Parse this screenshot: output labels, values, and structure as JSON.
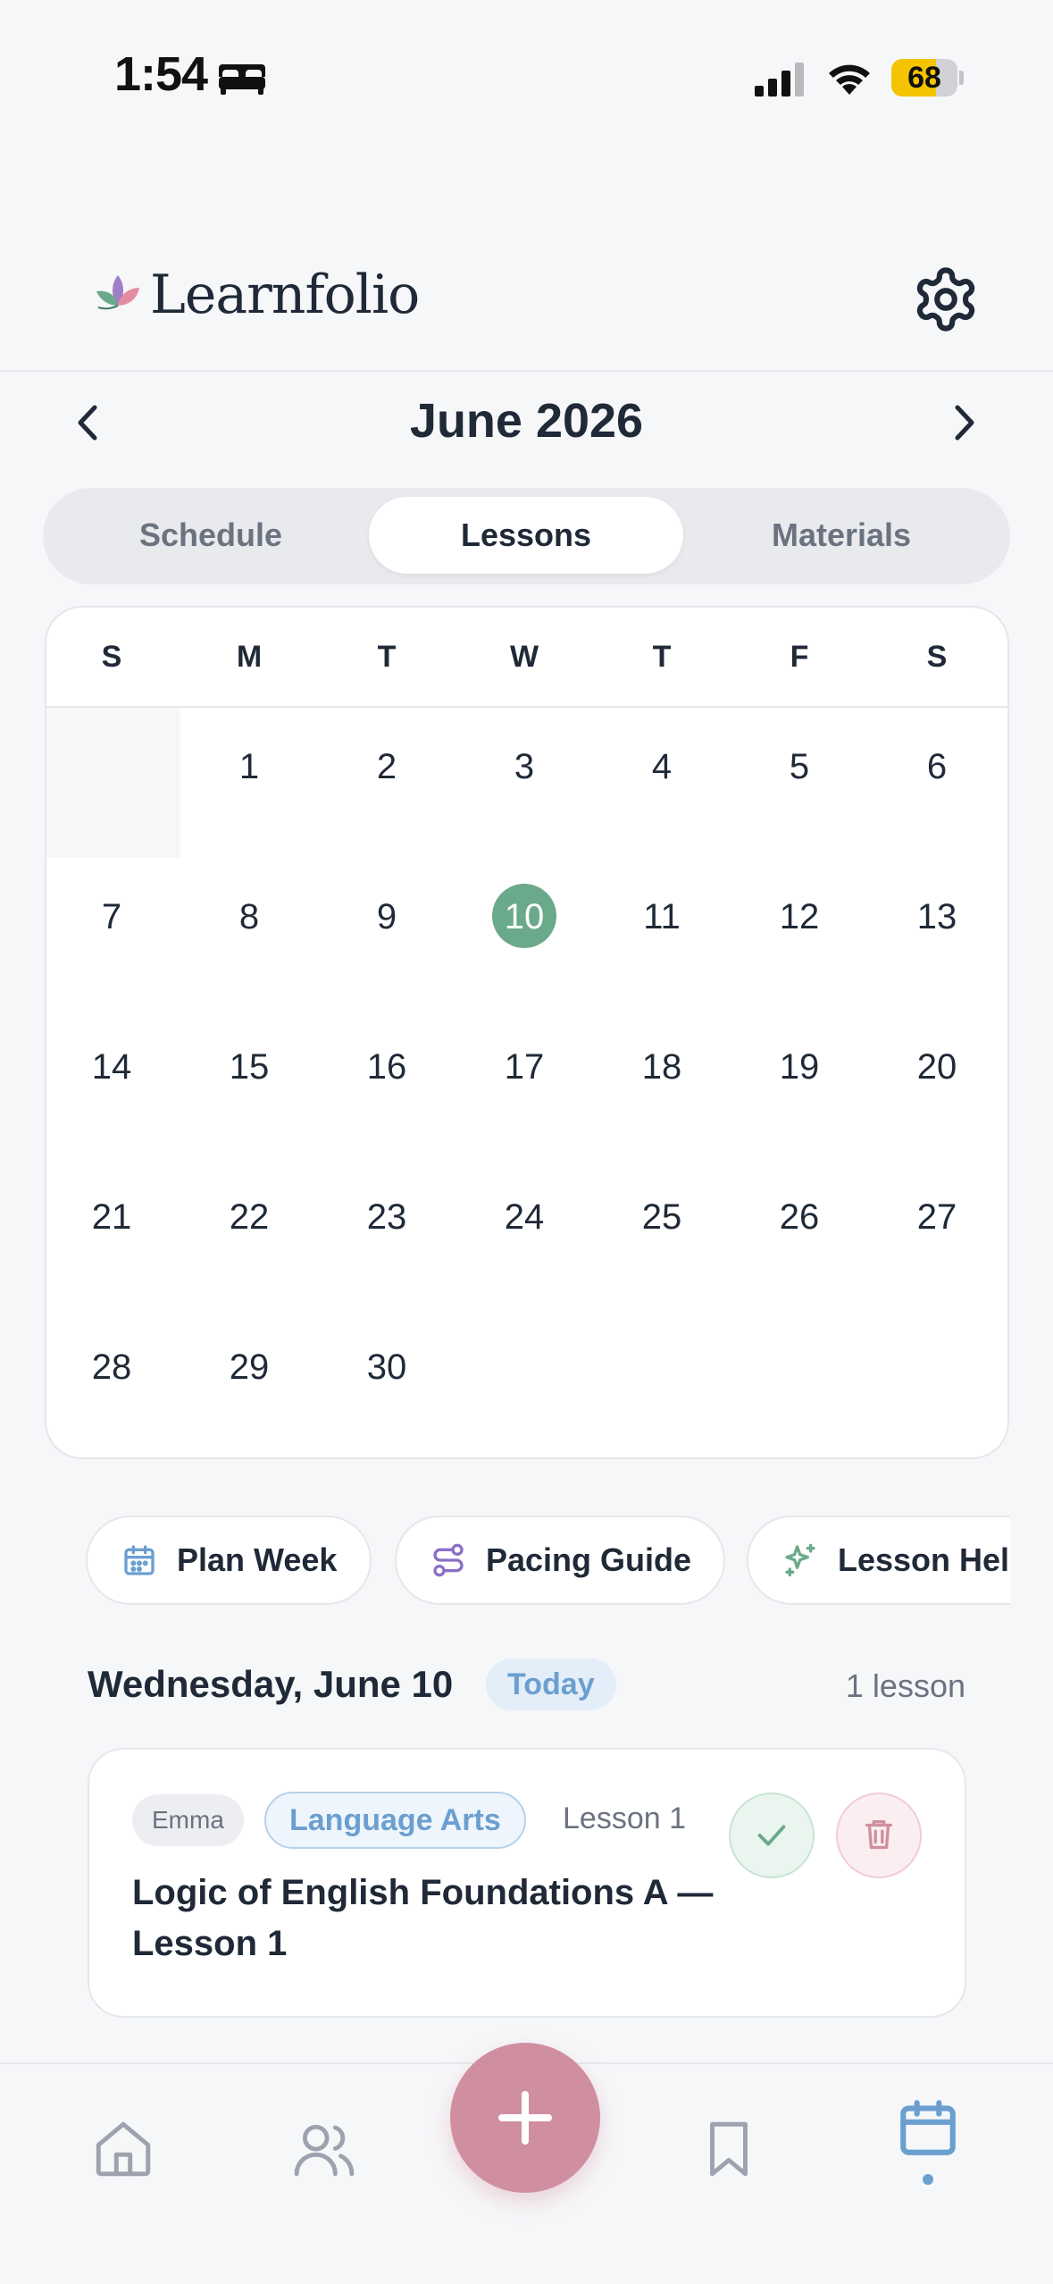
{
  "status_bar": {
    "time": "1:54",
    "battery": "68",
    "battery_level": 0.68
  },
  "header": {
    "app_name": "Learnfolio"
  },
  "calendar": {
    "month_title": "June 2026",
    "weekdays": [
      "S",
      "M",
      "T",
      "W",
      "T",
      "F",
      "S"
    ],
    "weeks": [
      [
        "",
        "1",
        "2",
        "3",
        "4",
        "5",
        "6"
      ],
      [
        "7",
        "8",
        "9",
        "10",
        "11",
        "12",
        "13"
      ],
      [
        "14",
        "15",
        "16",
        "17",
        "18",
        "19",
        "20"
      ],
      [
        "21",
        "22",
        "23",
        "24",
        "25",
        "26",
        "27"
      ],
      [
        "28",
        "29",
        "30",
        "",
        "",
        "",
        ""
      ]
    ],
    "today": "10"
  },
  "tabs": [
    {
      "label": "Schedule",
      "active": false
    },
    {
      "label": "Lessons",
      "active": true
    },
    {
      "label": "Materials",
      "active": false
    }
  ],
  "quick_actions": [
    {
      "label": "Plan Week",
      "icon": "calendar-icon"
    },
    {
      "label": "Pacing Guide",
      "icon": "route-icon"
    },
    {
      "label": "Lesson Help",
      "icon": "sparkles-icon"
    }
  ],
  "day": {
    "heading": "Wednesday, June 10",
    "badge": "Today",
    "count": "1 lesson"
  },
  "lessons": [
    {
      "student": "Emma",
      "subject": "Language Arts",
      "lesson_number": "Lesson 1",
      "title": "Logic of English Foundations A — Lesson 1"
    }
  ],
  "bottom_nav": [
    "home-icon",
    "students-icon",
    "add-icon",
    "bookmark-icon",
    "calendar-icon"
  ],
  "colors": {
    "accent_green": "#6aaa8a",
    "accent_blue": "#6b9fd0",
    "accent_pink": "#d08fa0",
    "background": "#f6f7f9"
  }
}
